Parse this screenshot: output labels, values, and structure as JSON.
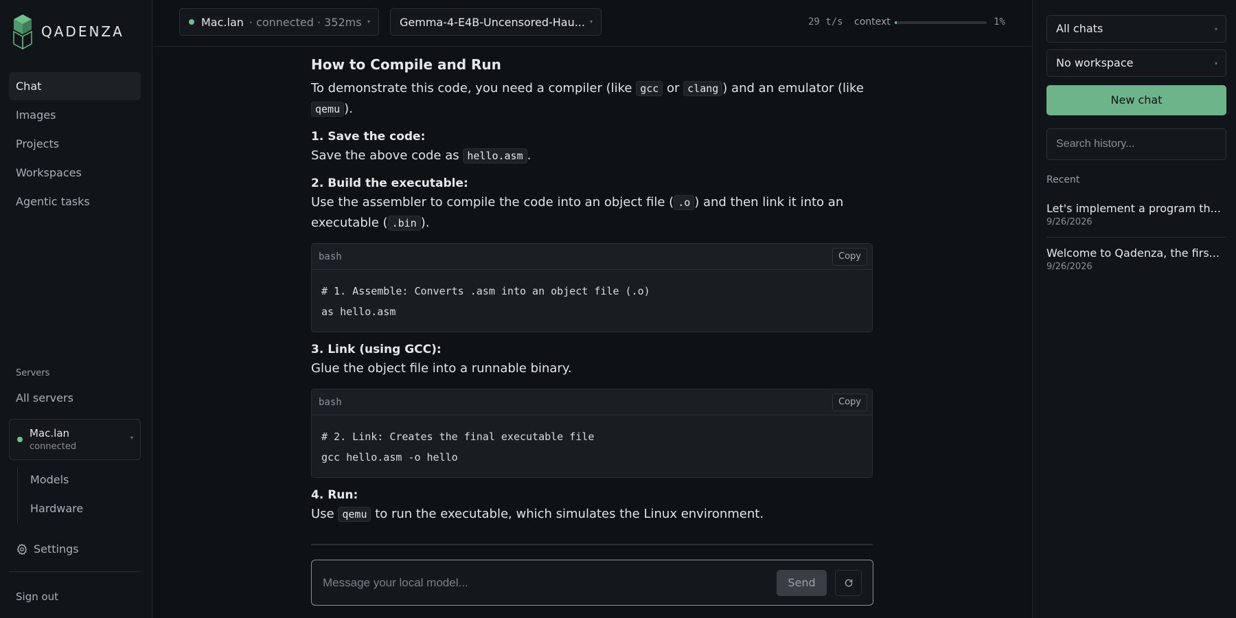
{
  "brand": {
    "name": "QADENZA"
  },
  "nav": {
    "items": [
      "Chat",
      "Images",
      "Projects",
      "Workspaces",
      "Agentic tasks"
    ]
  },
  "servers": {
    "label": "Servers",
    "all": "All servers",
    "current": {
      "name": "Mac.lan",
      "status": "connected"
    },
    "sub": [
      "Models",
      "Hardware"
    ]
  },
  "footer": {
    "settings": "Settings",
    "signout": "Sign out"
  },
  "topbar": {
    "server_name": "Mac.lan",
    "server_status": "· connected  ·  352ms",
    "model": "Gemma-4-E4B-Uncensored-Hau...",
    "tps": "29 t/s",
    "context_label": "context",
    "context_pct": "1%",
    "context_value": 0.01
  },
  "content": {
    "heading": "How to Compile and Run",
    "intro_a": "To demonstrate this code, you need a compiler (like ",
    "intro_code1": "gcc",
    "intro_b": " or ",
    "intro_code2": "clang",
    "intro_c": ") and an emulator (like ",
    "intro_code3": "qemu",
    "intro_d": ").",
    "step1_title": "1. Save the code:",
    "step1_a": "Save the above code as ",
    "step1_code": "hello.asm",
    "step1_b": ".",
    "step2_title": "2. Build the executable:",
    "step2_a": "Use the assembler to compile the code into an object file (",
    "step2_code1": ".o",
    "step2_b": ") and then link it into an executable (",
    "step2_code2": ".bin",
    "step2_c": ").",
    "code1": {
      "lang": "bash",
      "copy": "Copy",
      "lines": [
        "# 1. Assemble: Converts .asm into an object file (.o)",
        "as hello.asm"
      ]
    },
    "step3_title": "3. Link (using GCC):",
    "step3_text": "Glue the object file into a runnable binary.",
    "code2": {
      "lang": "bash",
      "copy": "Copy",
      "lines": [
        "# 2. Link: Creates the final executable file",
        "gcc hello.asm -o hello"
      ]
    },
    "step4_title": "4. Run:",
    "step4_a": "Use ",
    "step4_code": "qemu",
    "step4_b": " to run the executable, which simulates the Linux environment."
  },
  "composer": {
    "placeholder": "Message your local model...",
    "send": "Send"
  },
  "right": {
    "filter": "All chats",
    "workspace": "No workspace",
    "new_chat": "New chat",
    "search_placeholder": "Search history...",
    "recent_label": "Recent",
    "history": [
      {
        "title": "Let's implement a program th...",
        "date": "9/26/2026"
      },
      {
        "title": "Welcome to Qadenza, the firs...",
        "date": "9/26/2026"
      }
    ]
  },
  "colors": {
    "accent": "#6db48a",
    "status_dot": "#6fbf8b",
    "background": "#0e1115"
  }
}
